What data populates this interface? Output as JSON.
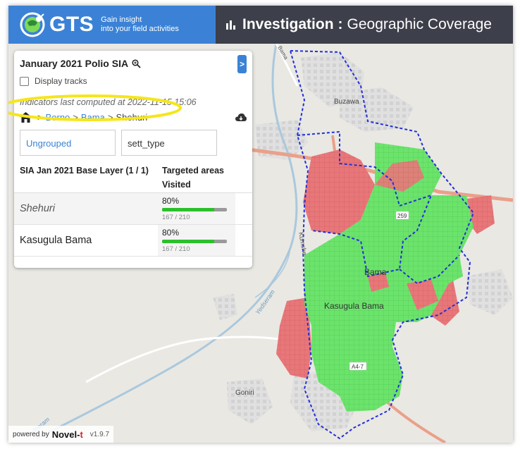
{
  "header": {
    "logo_text": "GTS",
    "tagline_line1": "Gain insight",
    "tagline_line2": "into your field activities",
    "title_bold": "Investigation",
    "title_sep": ":",
    "title_rest": "Geographic Coverage"
  },
  "panel": {
    "title": "January 2021 Polio SIA",
    "expand_label": ">",
    "display_tracks_label": "Display tracks",
    "display_tracks_checked": false,
    "computed_text": "Indicators last computed at 2022-11-15 15:06",
    "breadcrumb": {
      "sep": ">",
      "level1": "Borno",
      "level2": "Bama",
      "current": "Shehuri"
    },
    "group_buttons": {
      "ungrouped": "Ungrouped",
      "sett_type": "sett_type"
    },
    "table": {
      "col1_header": "SIA Jan 2021 Base Layer (1 / 1)",
      "col2_header": "Targeted areas Visited",
      "rows": [
        {
          "name": "Shehuri",
          "percent": "80%",
          "fraction": 0.8,
          "counts": "167 / 210"
        },
        {
          "name": "Kasugula Bama",
          "percent": "80%",
          "fraction": 0.8,
          "counts": "167 / 210"
        }
      ]
    }
  },
  "map_labels": {
    "buzawa": "Buzawa",
    "bama": "Bama",
    "kasugula_bama": "Kasugula Bama",
    "goniri": "Goniri",
    "yedseram": "Yedseram",
    "kumshe": "Kumshe",
    "road_a47": "A4-7",
    "road_259": "259",
    "bama_road": "Bama"
  },
  "footer": {
    "powered_by": "powered by",
    "brand_main": "Novel-",
    "brand_accent": "t",
    "version": "v1.9.7"
  },
  "colors": {
    "brand_blue": "#3b82d6",
    "title_bar": "#3d3f4a",
    "visited_green": "#6ce46c",
    "unvisited_red": "#e8777a",
    "boundary_blue": "#2230d8"
  },
  "icons": [
    "globe-logo-icon",
    "bar-chart-icon",
    "zoom-icon",
    "home-icon",
    "cloud-download-icon"
  ]
}
